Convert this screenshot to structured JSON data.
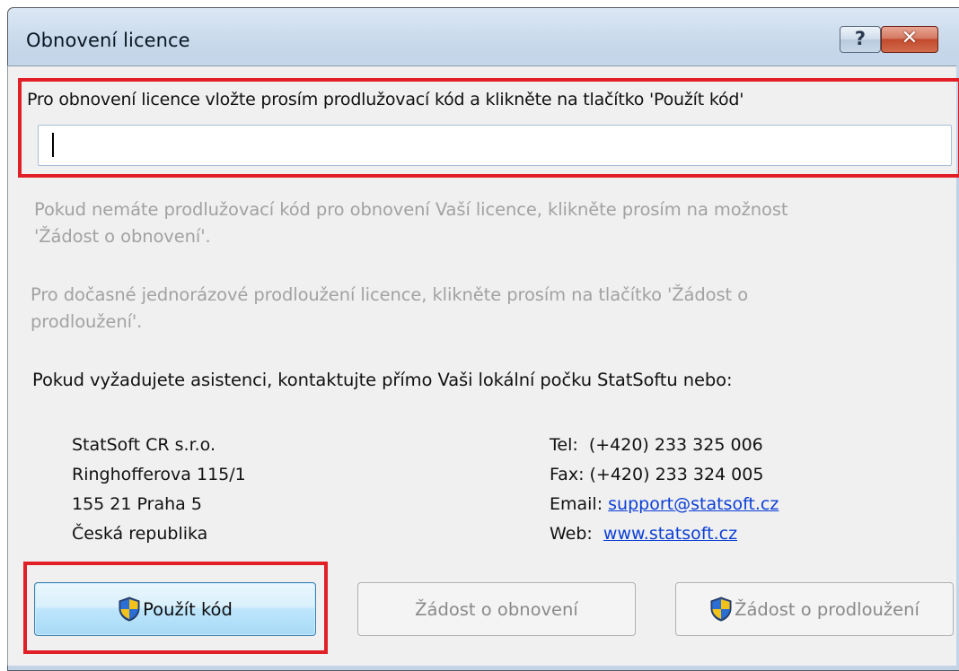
{
  "window": {
    "title": "Obnovení licence",
    "help_glyph": "?",
    "close_glyph": "✕"
  },
  "instruction": {
    "text": "Pro obnovení licence vložte prosím prodlužovací kód a klikněte na tlačítko 'Použít kód'"
  },
  "code_input": {
    "value": "",
    "placeholder": ""
  },
  "paragraphs": {
    "renew_hint_line1": "Pokud nemáte prodlužovací kód pro obnovení Vaší licence, klikněte prosím na možnost",
    "renew_hint_line2": "'Žádost o obnovení'.",
    "extend_hint_line1": "Pro dočasné jednorázové prodloužení licence, klikněte prosím na tlačítko 'Žádost o",
    "extend_hint_line2": "prodloužení'.",
    "assist": "Pokud vyžadujete asistenci, kontaktujte přímo Vaši lokální počku StatSoftu nebo:"
  },
  "contact": {
    "company": "StatSoft CR s.r.o.",
    "street": "Ringhofferova 115/1",
    "city": "155 21 Praha 5",
    "country": "Česká republika",
    "tel_label": "Tel:  ",
    "tel_value": "(+420) 233 325 006",
    "fax_label": "Fax: ",
    "fax_value": "(+420) 233 324 005",
    "email_label": "Email: ",
    "email_value": "support@statsoft.cz",
    "web_label": "Web:  ",
    "web_value": "www.statsoft.cz"
  },
  "buttons": {
    "apply_code": "Použít kód",
    "request_renewal": "Žádost o obnovení",
    "request_extension": "Žádost o prodloužení"
  },
  "icons": {
    "shield": "uac-shield-icon",
    "help": "help-icon",
    "close": "close-icon"
  },
  "colors": {
    "highlight": "#e01f26",
    "link": "#0b3fd6",
    "disabled_text": "#a2a2a2",
    "close_button": "#c24a2d"
  }
}
